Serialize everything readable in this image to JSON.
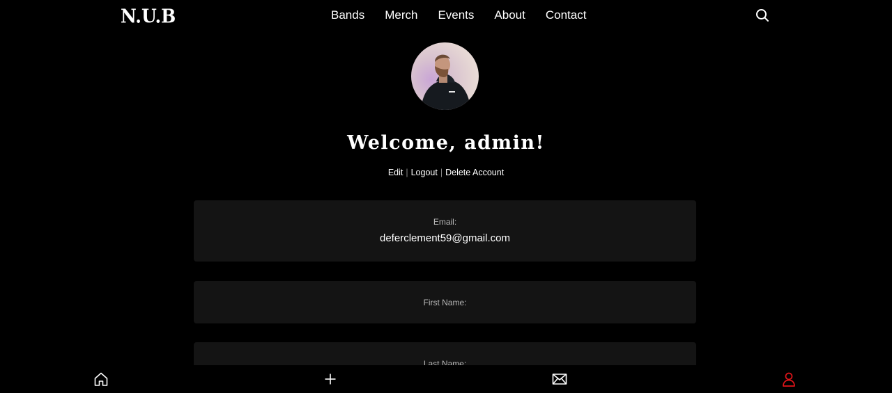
{
  "header": {
    "logo": "N.U.B",
    "nav": [
      "Bands",
      "Merch",
      "Events",
      "About",
      "Contact"
    ],
    "search_icon": "search-icon"
  },
  "profile": {
    "welcome": "Welcome, admin!",
    "links": {
      "edit": "Edit",
      "logout": "Logout",
      "delete": "Delete Account",
      "separator": "|"
    }
  },
  "fields": {
    "email": {
      "label": "Email:",
      "value": "deferclement59@gmail.com"
    },
    "first_name": {
      "label": "First Name:",
      "value": ""
    },
    "last_name": {
      "label": "Last Name:",
      "value": ""
    }
  },
  "bottom_nav": {
    "icons": [
      "home-icon",
      "plus-icon",
      "mail-icon",
      "user-icon"
    ],
    "active_color": "#e3151a"
  }
}
